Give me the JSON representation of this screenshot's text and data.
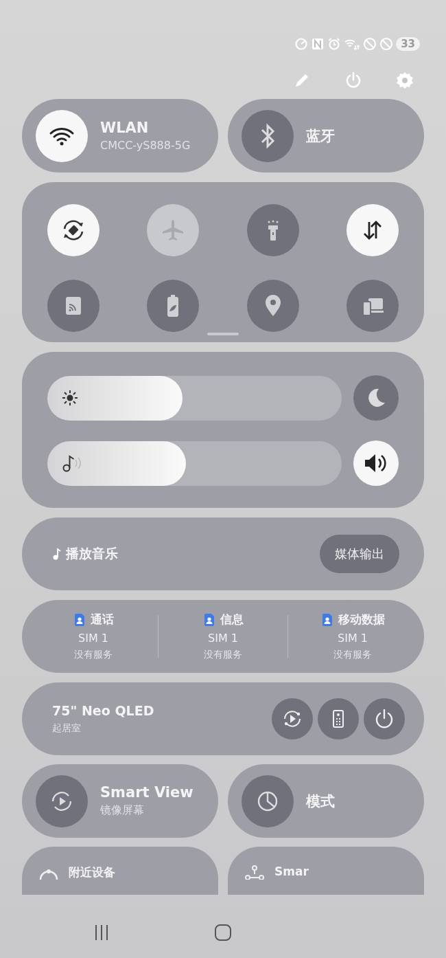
{
  "status_bar": {
    "battery": "33"
  },
  "tiles": [
    {
      "title": "WLAN",
      "subtitle": "CMCC-yS888-5G",
      "on": true
    },
    {
      "title": "蓝牙",
      "on": false
    }
  ],
  "quick_toggles": [
    {
      "on": true,
      "disabled": false
    },
    {
      "on": false,
      "disabled": true
    },
    {
      "on": false,
      "disabled": false
    },
    {
      "on": true,
      "disabled": false
    },
    {
      "on": false,
      "disabled": false
    },
    {
      "on": false,
      "disabled": false
    },
    {
      "on": false,
      "disabled": false
    },
    {
      "on": false,
      "disabled": false
    }
  ],
  "sliders": [
    {
      "kind": "brightness",
      "level": 0.46,
      "side_on": false
    },
    {
      "kind": "volume",
      "level": 0.47,
      "side_on": true
    }
  ],
  "media": {
    "label": "播放音乐",
    "button": "媒体输出"
  },
  "sim": [
    {
      "title": "通话",
      "sim": "SIM 1",
      "status": "没有服务"
    },
    {
      "title": "信息",
      "sim": "SIM 1",
      "status": "没有服务"
    },
    {
      "title": "移动数据",
      "sim": "SIM 1",
      "status": "没有服务"
    }
  ],
  "device": {
    "name": "75\" Neo QLED",
    "room": "起居室"
  },
  "bottom_tiles": [
    {
      "title": "Smart View",
      "subtitle": "镜像屏幕",
      "on": false
    },
    {
      "title": "模式",
      "on": false
    }
  ],
  "partial_tiles": [
    {
      "title": "附近设备"
    },
    {
      "title": "Smar"
    }
  ]
}
